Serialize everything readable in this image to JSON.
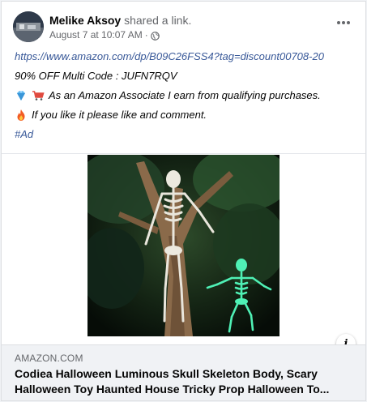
{
  "post": {
    "author": "Melike Aksoy",
    "action": "shared a link.",
    "timestamp": "August 7 at 10:07 AM",
    "separator": "·",
    "privacy_icon": "globe-icon",
    "more_icon": "more-horizontal-icon",
    "lines": {
      "url": "https://www.amazon.com/dp/B09C26FSS4?tag=discount00708-20",
      "code": "90% OFF Multi Code : JUFN7RQV",
      "associate": "As an Amazon Associate I earn from qualifying purchases.",
      "like": "If you like it please like and comment.",
      "hashtag": "#Ad"
    },
    "emojis": {
      "associate": [
        "gem-icon",
        "shopping-cart-icon"
      ],
      "like": "fire-icon"
    }
  },
  "link_preview": {
    "domain": "AMAZON.COM",
    "title_line1": "Codiea Halloween Luminous Skull Skeleton Body, Scary",
    "title_line2": "Halloween Toy Haunted House Tricky Prop Halloween To...",
    "info_label": "i"
  },
  "colors": {
    "link": "#385898",
    "muted": "#65676b",
    "preview_bg": "#f0f2f5"
  }
}
